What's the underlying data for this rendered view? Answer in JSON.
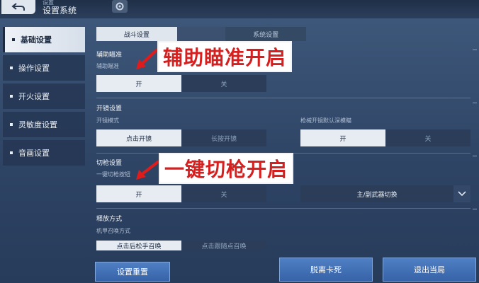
{
  "topbar": {
    "subtitle": "设置",
    "title": "设置系统",
    "back_icon": "back-arrow-icon",
    "gear_icon": "gear-icon"
  },
  "sidebar": {
    "items": [
      {
        "label": "基础设置",
        "active": true
      },
      {
        "label": "操作设置",
        "active": false
      },
      {
        "label": "开火设置",
        "active": false
      },
      {
        "label": "灵敏度设置",
        "active": false
      },
      {
        "label": "音画设置",
        "active": false
      }
    ]
  },
  "tabs": {
    "battle": "战斗设置",
    "system": "系统设置"
  },
  "aim_assist": {
    "section": "辅助瞄准",
    "label": "辅助瞄准",
    "on": "开",
    "off": "关"
  },
  "scope": {
    "section": "开镜设置",
    "mode_label": "开镜模式",
    "mode_tap": "点击开镜",
    "mode_hold": "长按开镜",
    "mech_label": "枪械开镜默认深模瞄",
    "mech_on": "开",
    "mech_off": "关"
  },
  "switch_gun": {
    "section": "切枪设置",
    "label": "一键切枪按钮",
    "on": "开",
    "off": "关",
    "dropdown_value": "主/副武器切换"
  },
  "release": {
    "section": "释放方式",
    "label": "机甲召唤方式",
    "opt1": "点击后松手召唤",
    "opt2": "点击跟随点召唤"
  },
  "buttons": {
    "reset": "设置重置",
    "unstuck": "脱离卡死",
    "quit": "退出当局"
  },
  "captions": {
    "aim": "辅助瞄准开启",
    "switch": "一键切枪开启"
  },
  "colors": {
    "caption_text": "#d62020",
    "accent_button": "#3763a8"
  }
}
